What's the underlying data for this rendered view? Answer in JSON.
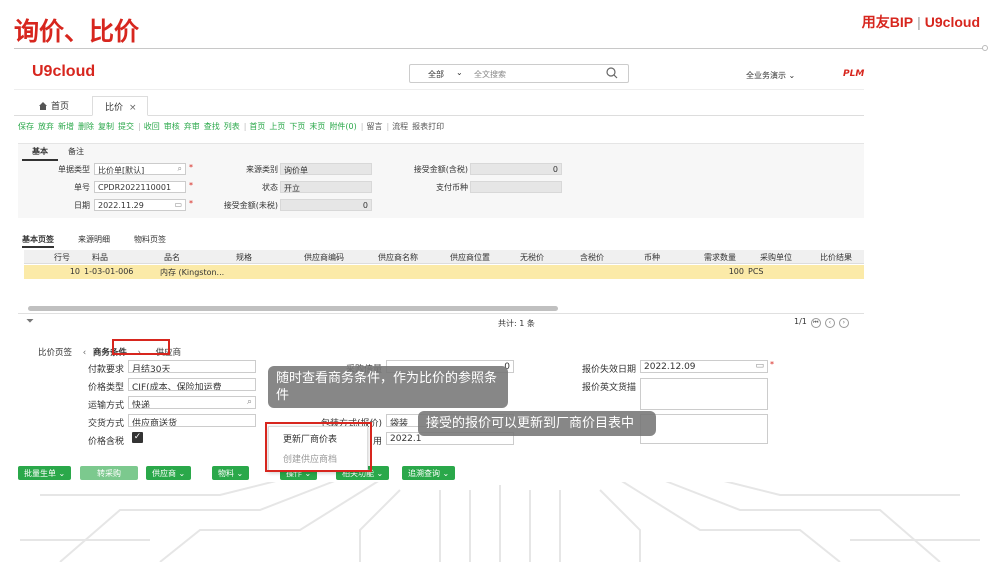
{
  "slide": {
    "title": "询价、比价",
    "brand_left": "用友BIP",
    "brand_sep": "|",
    "brand_right": "U9cloud"
  },
  "app": {
    "logo": "U9cloud",
    "search": {
      "scope": "全部",
      "placeholder": "全文搜索"
    },
    "business_demo": "全业务演示 ⌄",
    "plm": "PLM"
  },
  "tabs": {
    "home": "首页",
    "compare": "比价",
    "close": "×"
  },
  "toolbar": {
    "items": [
      "保存",
      "放弃",
      "新增",
      "删除",
      "复制",
      "提交",
      "收回",
      "审核",
      "弃审",
      "查找",
      "列表",
      "首页",
      "上页",
      "下页",
      "末页",
      "附件(0)",
      "留言",
      "流程",
      "报表打印"
    ]
  },
  "basic": {
    "subtabs": [
      "基本",
      "备注"
    ],
    "doc_type_label": "单据类型",
    "doc_type_value": "比价单[默认]",
    "doc_no_label": "单号",
    "doc_no_value": "CPDR2022110001",
    "date_label": "日期",
    "date_value": "2022.11.29",
    "source_type_label": "来源类别",
    "source_type_value": "询价单",
    "status_label": "状态",
    "status_value": "开立",
    "accept_amount_untaxed_label": "接受金额(未税)",
    "accept_amount_untaxed_value": "0",
    "accept_amount_taxed_label": "接受金额(含税)",
    "accept_amount_taxed_value": "0",
    "currency_label": "支付币种"
  },
  "grid": {
    "tabs": [
      "基本页签",
      "来源明细",
      "物料页签"
    ],
    "headers": [
      "行号",
      "料品",
      "品名",
      "规格",
      "供应商编码",
      "供应商名称",
      "供应商位置",
      "无税价",
      "含税价",
      "币种",
      "需求数量",
      "采购单位",
      "比价结果"
    ],
    "row": {
      "line": "10",
      "item": "1-03-01-006",
      "name": "内存 (Kingston...",
      "qty": "100",
      "unit": "PCS"
    },
    "total": "共计: 1 条",
    "page": "1/1"
  },
  "biz": {
    "tabs": [
      "比价页签",
      "商务条件",
      "供应商"
    ],
    "payment_label": "付款要求",
    "payment_value": "月结30天",
    "price_type_label": "价格类型",
    "price_type_value": "CIF(成本、保险加运费",
    "transport_label": "运输方式",
    "transport_value": "快递",
    "delivery_label": "交货方式",
    "delivery_value": "供应商送货",
    "tax_label": "价格含税",
    "purchase_qty_label": "采购倍量",
    "purchase_qty_value": "0",
    "packing_label": "包装方式(报价)",
    "packing_value": "袋装",
    "quote_date_label": "报价失效日期",
    "quote_date_value": "2022.12.09",
    "quote_en_label": "报价英文货描",
    "date_partial": "2022.1",
    "field_partial": "用"
  },
  "dropdown": {
    "item1": "更新厂商价表",
    "item2": "创建供应商档"
  },
  "callouts": {
    "c1": "随时查看商务条件，作为比价的参照条件",
    "c2": "接受的报价可以更新到厂商价目表中"
  },
  "bottom_buttons": [
    "批量生单 ⌄",
    "转采购",
    "供应商 ⌄",
    "物料 ⌄",
    "操作 ⌄",
    "相关功能 ⌄",
    "追溯查询 ⌄"
  ],
  "colors": {
    "brand_red": "#d7261e",
    "action_green": "#2aa84a",
    "highlight_row": "#fbeaa8"
  }
}
